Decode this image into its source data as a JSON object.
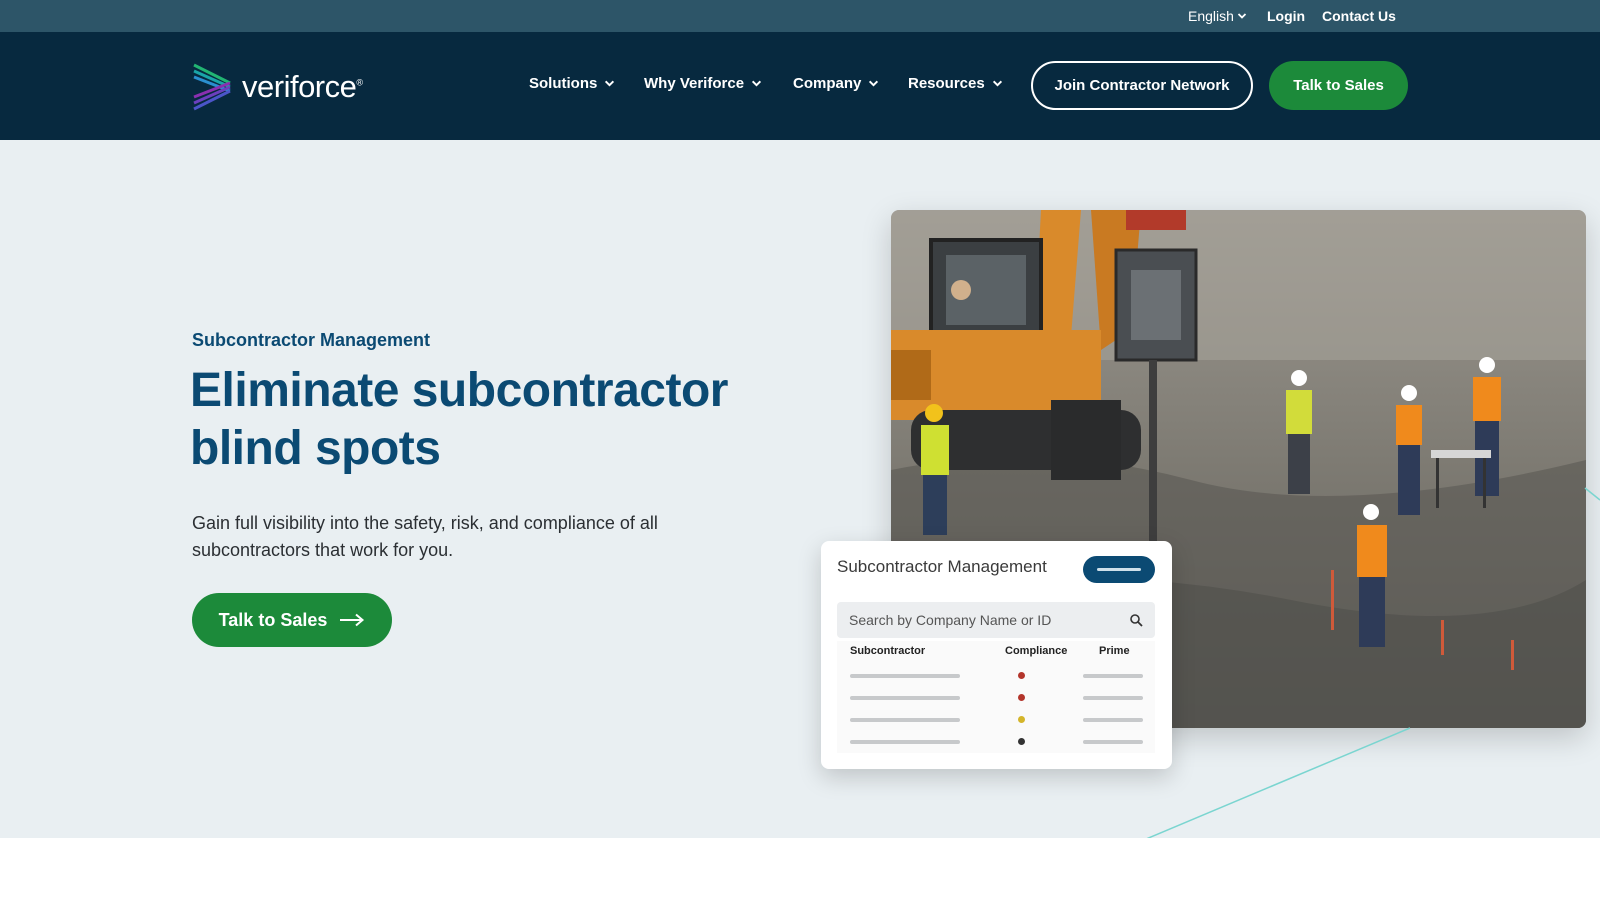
{
  "utility_bar": {
    "language": "English",
    "login": "Login",
    "contact": "Contact Us"
  },
  "nav": {
    "logo_text": "veriforce",
    "items": [
      {
        "label": "Solutions"
      },
      {
        "label": "Why Veriforce"
      },
      {
        "label": "Company"
      },
      {
        "label": "Resources"
      }
    ],
    "join_button": "Join Contractor Network",
    "sales_button": "Talk to Sales"
  },
  "hero": {
    "eyebrow": "Subcontractor Management",
    "headline": "Eliminate subcontractor blind spots",
    "subcopy": "Gain full visibility into the safety, risk, and compliance of all subcontractors that work for you.",
    "cta": "Talk to Sales"
  },
  "card": {
    "title": "Subcontractor Management",
    "search_placeholder": "Search by Company Name or ID",
    "columns": [
      "Subcontractor",
      "Compliance",
      "Prime"
    ],
    "rows": [
      {
        "compliance_color": "#b3352b"
      },
      {
        "compliance_color": "#b3352b"
      },
      {
        "compliance_color": "#d4b52a"
      },
      {
        "compliance_color": "#333333"
      }
    ]
  },
  "colors": {
    "utility_bar": "#2d5568",
    "nav_bg": "#07293f",
    "brand_green": "#1c8a3a",
    "headline_blue": "#0b4a73",
    "hero_bg": "#e9eff2"
  }
}
